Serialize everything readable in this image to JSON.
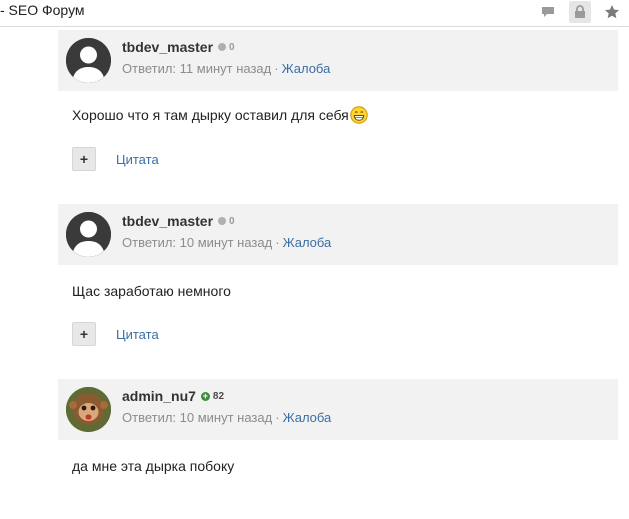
{
  "browser": {
    "tab_title": "- SEO Форум",
    "icons": [
      "comment-icon",
      "lock-icon",
      "star-icon"
    ]
  },
  "posts": [
    {
      "username": "tbdev_master",
      "reputation": "0",
      "reputation_type": "neutral",
      "answered": "Ответил: 11 минут назад",
      "separator": "·",
      "report": "Жалоба",
      "body": "Хорошо что я там дырку оставил для себя",
      "has_smiley": true,
      "quote": "Цитата",
      "plus": "+"
    },
    {
      "username": "tbdev_master",
      "reputation": "0",
      "reputation_type": "neutral",
      "answered": "Ответил: 10 минут назад",
      "separator": "·",
      "report": "Жалоба",
      "body": "Щас заработаю немного",
      "has_smiley": false,
      "quote": "Цитата",
      "plus": "+"
    },
    {
      "username": "admin_nu7",
      "reputation": "82",
      "reputation_type": "positive",
      "answered": "Ответил: 10 минут назад",
      "separator": "·",
      "report": "Жалоба",
      "body": "да мне эта дырка побоку"
    }
  ],
  "colors": {
    "header_bg": "#f2f2f2",
    "link": "#3a6ea5",
    "meta": "#8c8c8c",
    "rep_positive": "#3d8b3d"
  }
}
